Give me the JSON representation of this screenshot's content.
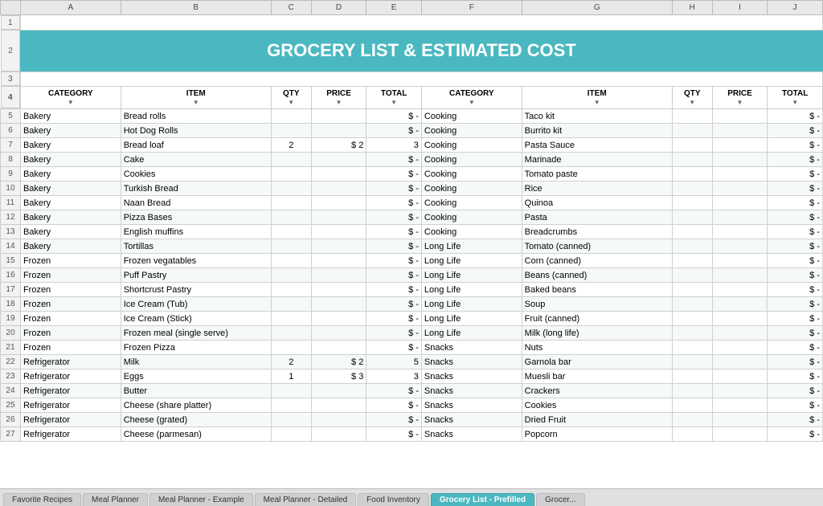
{
  "title": "GROCERY LIST & ESTIMATED COST",
  "columnHeaders": [
    "A",
    "B",
    "C",
    "D",
    "E",
    "F",
    "G",
    "H",
    "I",
    "J"
  ],
  "fieldHeaders": {
    "category1": "CATEGORY",
    "item1": "ITEM",
    "qty1": "QTY",
    "price1": "PRICE",
    "total1": "TOTAL",
    "category2": "CATEGORY",
    "item2": "ITEM",
    "qty2": "QTY",
    "price2": "PRICE",
    "total2": "TOTAL"
  },
  "rows": [
    {
      "row": 5,
      "cat1": "Bakery",
      "item1": "Bread rolls",
      "qty1": "",
      "price1": "",
      "total1": "$   -",
      "cat2": "Cooking",
      "item2": "Taco kit",
      "qty2": "",
      "price2": "",
      "total2": "$   -"
    },
    {
      "row": 6,
      "cat1": "Bakery",
      "item1": "Hot Dog Rolls",
      "qty1": "",
      "price1": "",
      "total1": "$   -",
      "cat2": "Cooking",
      "item2": "Burrito kit",
      "qty2": "",
      "price2": "",
      "total2": "$   -"
    },
    {
      "row": 7,
      "cat1": "Bakery",
      "item1": "Bread loaf",
      "qty1": "2",
      "price1": "$ 2",
      "total1": "3",
      "cat2": "Cooking",
      "item2": "Pasta Sauce",
      "qty2": "",
      "price2": "",
      "total2": "$   -"
    },
    {
      "row": 8,
      "cat1": "Bakery",
      "item1": "Cake",
      "qty1": "",
      "price1": "",
      "total1": "$   -",
      "cat2": "Cooking",
      "item2": "Marinade",
      "qty2": "",
      "price2": "",
      "total2": "$   -"
    },
    {
      "row": 9,
      "cat1": "Bakery",
      "item1": "Cookies",
      "qty1": "",
      "price1": "",
      "total1": "$   -",
      "cat2": "Cooking",
      "item2": "Tomato paste",
      "qty2": "",
      "price2": "",
      "total2": "$   -"
    },
    {
      "row": 10,
      "cat1": "Bakery",
      "item1": "Turkish Bread",
      "qty1": "",
      "price1": "",
      "total1": "$   -",
      "cat2": "Cooking",
      "item2": "Rice",
      "qty2": "",
      "price2": "",
      "total2": "$   -"
    },
    {
      "row": 11,
      "cat1": "Bakery",
      "item1": "Naan Bread",
      "qty1": "",
      "price1": "",
      "total1": "$   -",
      "cat2": "Cooking",
      "item2": "Quinoa",
      "qty2": "",
      "price2": "",
      "total2": "$   -"
    },
    {
      "row": 12,
      "cat1": "Bakery",
      "item1": "Pizza Bases",
      "qty1": "",
      "price1": "",
      "total1": "$   -",
      "cat2": "Cooking",
      "item2": "Pasta",
      "qty2": "",
      "price2": "",
      "total2": "$   -"
    },
    {
      "row": 13,
      "cat1": "Bakery",
      "item1": "English muffins",
      "qty1": "",
      "price1": "",
      "total1": "$   -",
      "cat2": "Cooking",
      "item2": "Breadcrumbs",
      "qty2": "",
      "price2": "",
      "total2": "$   -"
    },
    {
      "row": 14,
      "cat1": "Bakery",
      "item1": "Tortillas",
      "qty1": "",
      "price1": "",
      "total1": "$   -",
      "cat2": "Long Life",
      "item2": "Tomato (canned)",
      "qty2": "",
      "price2": "",
      "total2": "$   -"
    },
    {
      "row": 15,
      "cat1": "Frozen",
      "item1": "Frozen vegatables",
      "qty1": "",
      "price1": "",
      "total1": "$   -",
      "cat2": "Long Life",
      "item2": "Corn (canned)",
      "qty2": "",
      "price2": "",
      "total2": "$   -"
    },
    {
      "row": 16,
      "cat1": "Frozen",
      "item1": "Puff Pastry",
      "qty1": "",
      "price1": "",
      "total1": "$   -",
      "cat2": "Long Life",
      "item2": "Beans (canned)",
      "qty2": "",
      "price2": "",
      "total2": "$   -"
    },
    {
      "row": 17,
      "cat1": "Frozen",
      "item1": "Shortcrust Pastry",
      "qty1": "",
      "price1": "",
      "total1": "$   -",
      "cat2": "Long Life",
      "item2": "Baked beans",
      "qty2": "",
      "price2": "",
      "total2": "$   -"
    },
    {
      "row": 18,
      "cat1": "Frozen",
      "item1": "Ice Cream (Tub)",
      "qty1": "",
      "price1": "",
      "total1": "$   -",
      "cat2": "Long Life",
      "item2": "Soup",
      "qty2": "",
      "price2": "",
      "total2": "$   -"
    },
    {
      "row": 19,
      "cat1": "Frozen",
      "item1": "Ice Cream (Stick)",
      "qty1": "",
      "price1": "",
      "total1": "$   -",
      "cat2": "Long Life",
      "item2": "Fruit (canned)",
      "qty2": "",
      "price2": "",
      "total2": "$   -"
    },
    {
      "row": 20,
      "cat1": "Frozen",
      "item1": "Frozen meal (single serve)",
      "qty1": "",
      "price1": "",
      "total1": "$   -",
      "cat2": "Long Life",
      "item2": "Milk (long life)",
      "qty2": "",
      "price2": "",
      "total2": "$   -"
    },
    {
      "row": 21,
      "cat1": "Frozen",
      "item1": "Frozen Pizza",
      "qty1": "",
      "price1": "",
      "total1": "$   -",
      "cat2": "Snacks",
      "item2": "Nuts",
      "qty2": "",
      "price2": "",
      "total2": "$   -"
    },
    {
      "row": 22,
      "cat1": "Refrigerator",
      "item1": "Milk",
      "qty1": "2",
      "price1": "$ 2",
      "total1": "5",
      "cat2": "Snacks",
      "item2": "Garnola bar",
      "qty2": "",
      "price2": "",
      "total2": "$   -"
    },
    {
      "row": 23,
      "cat1": "Refrigerator",
      "item1": "Eggs",
      "qty1": "1",
      "price1": "$ 3",
      "total1": "3",
      "cat2": "Snacks",
      "item2": "Muesli bar",
      "qty2": "",
      "price2": "",
      "total2": "$   -"
    },
    {
      "row": 24,
      "cat1": "Refrigerator",
      "item1": "Butter",
      "qty1": "",
      "price1": "",
      "total1": "$   -",
      "cat2": "Snacks",
      "item2": "Crackers",
      "qty2": "",
      "price2": "",
      "total2": "$   -"
    },
    {
      "row": 25,
      "cat1": "Refrigerator",
      "item1": "Cheese (share platter)",
      "qty1": "",
      "price1": "",
      "total1": "$   -",
      "cat2": "Snacks",
      "item2": "Cookies",
      "qty2": "",
      "price2": "",
      "total2": "$   -"
    },
    {
      "row": 26,
      "cat1": "Refrigerator",
      "item1": "Cheese (grated)",
      "qty1": "",
      "price1": "",
      "total1": "$   -",
      "cat2": "Snacks",
      "item2": "Dried Fruit",
      "qty2": "",
      "price2": "",
      "total2": "$   -"
    },
    {
      "row": 27,
      "cat1": "Refrigerator",
      "item1": "Cheese (parmesan)",
      "qty1": "",
      "price1": "",
      "total1": "$   -",
      "cat2": "Snacks",
      "item2": "Popcorn",
      "qty2": "",
      "price2": "",
      "total2": "$   -"
    }
  ],
  "tabs": [
    {
      "label": "Favorite Recipes",
      "active": false
    },
    {
      "label": "Meal Planner",
      "active": false
    },
    {
      "label": "Meal Planner - Example",
      "active": false
    },
    {
      "label": "Meal Planner - Detailed",
      "active": false
    },
    {
      "label": "Food Inventory",
      "active": false
    },
    {
      "label": "Grocery List - Prefilled",
      "active": true
    },
    {
      "label": "Grocer...",
      "active": false
    }
  ]
}
